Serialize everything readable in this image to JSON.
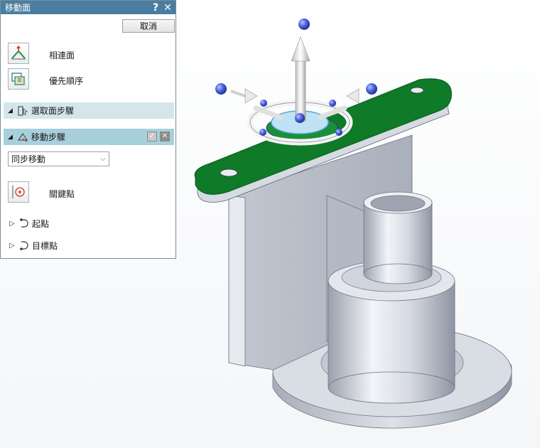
{
  "panel": {
    "title": "移動面",
    "help_icon": "?",
    "close_icon": "✕",
    "cancel_label": "取消",
    "option_connected_label": "相連面",
    "option_priority_label": "優先順序",
    "step_select_label": "選取面步驟",
    "step_move_label": "移動步驟",
    "move_mode": {
      "selected": "同步移動"
    },
    "keypoint_label": "關鍵點",
    "start_point_label": "起點",
    "target_point_label": "目標點"
  },
  "icons": [
    "connected-faces-icon",
    "priority-order-icon",
    "select-face-step-icon",
    "move-step-icon",
    "accept-icon",
    "reset-icon",
    "keypoint-icon",
    "start-point-icon",
    "target-point-icon",
    "steering-wheel-icon"
  ],
  "colors": {
    "titlebar": "#4a7ea0",
    "step_select_bg": "#d4e6ec",
    "step_move_bg": "#a8cfdc",
    "selected_face": "#0f7a28",
    "model_gray": "#c7ccd6",
    "handle_blue": "#3a55d8"
  }
}
